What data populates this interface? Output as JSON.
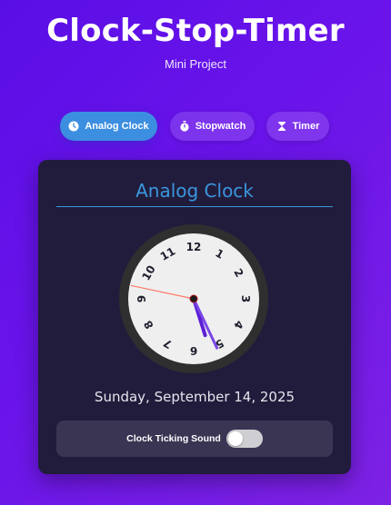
{
  "header": {
    "title": "Clock-Stop-Timer",
    "subtitle": "Mini Project"
  },
  "tabs": [
    {
      "label": "Analog Clock",
      "icon": "clock-icon",
      "active": true
    },
    {
      "label": "Stopwatch",
      "icon": "stopwatch-icon",
      "active": false
    },
    {
      "label": "Timer",
      "icon": "hourglass-icon",
      "active": false
    }
  ],
  "card": {
    "title": "Analog Clock",
    "clock": {
      "numerals": [
        "12",
        "1",
        "2",
        "3",
        "4",
        "5",
        "6",
        "7",
        "8",
        "9",
        "10",
        "11"
      ],
      "time": {
        "hour": 5,
        "minute": 25,
        "second": 47
      }
    },
    "date": "Sunday, September 14, 2025",
    "sound": {
      "label": "Clock Ticking Sound",
      "enabled": false
    }
  },
  "colors": {
    "accent": "#3a96de",
    "card_bg": "#211c3b",
    "hand_color": "#5b1fd6",
    "second_hand": "#ff7a6a"
  }
}
